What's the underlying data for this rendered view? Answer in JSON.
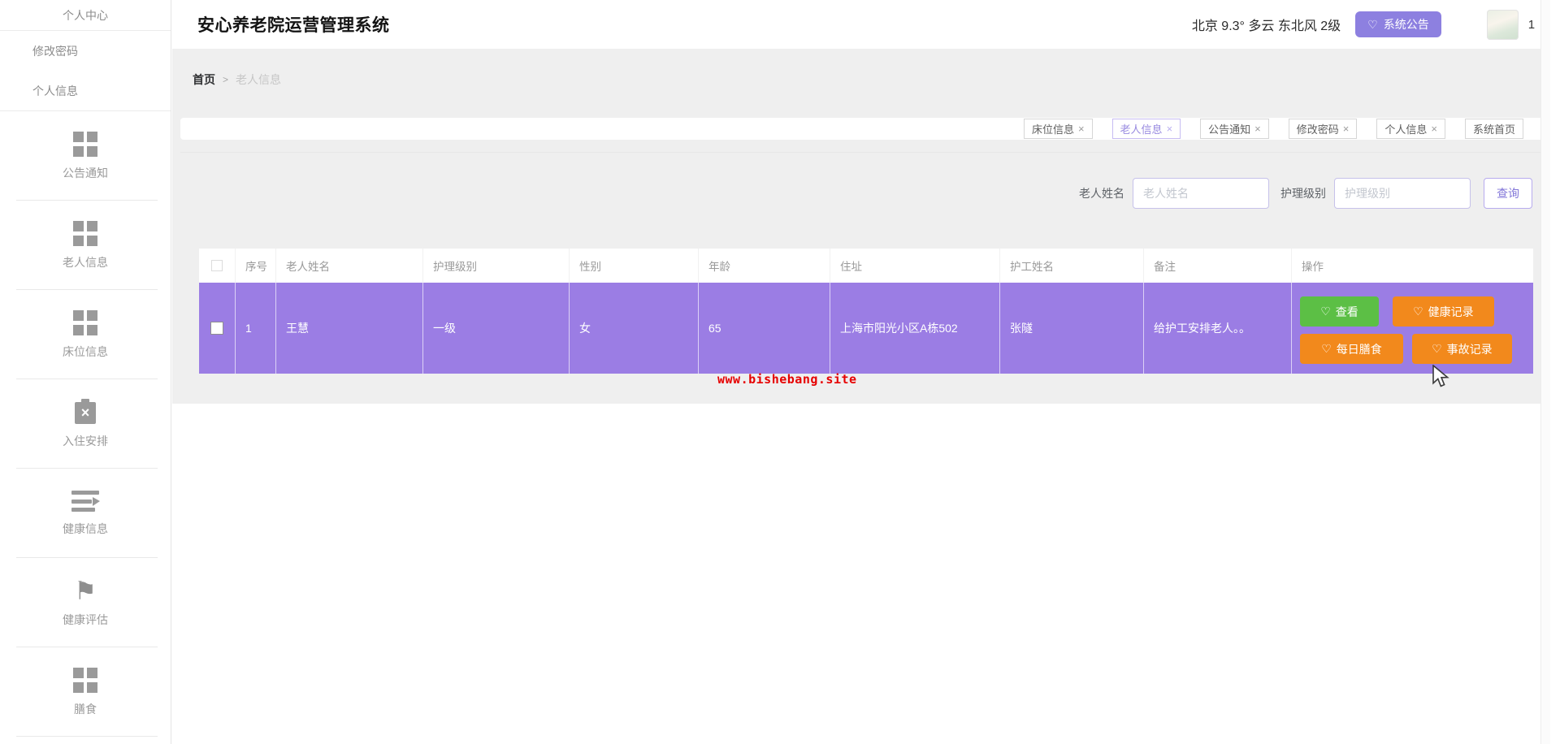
{
  "app": {
    "title": "安心养老院运营管理系统"
  },
  "header": {
    "weather": "北京  9.3°  多云  东北风  2级",
    "announcement_button": "系统公告",
    "user_badge": "1"
  },
  "sidebar": {
    "top_items": [
      {
        "label": "个人中心"
      },
      {
        "label": "修改密码"
      },
      {
        "label": "个人信息"
      }
    ],
    "menu_items": [
      {
        "label": "公告通知",
        "icon": "grid-icon"
      },
      {
        "label": "老人信息",
        "icon": "grid-icon"
      },
      {
        "label": "床位信息",
        "icon": "grid-icon"
      },
      {
        "label": "入住安排",
        "icon": "clipboard-x-icon"
      },
      {
        "label": "健康信息",
        "icon": "list-arrow-icon"
      },
      {
        "label": "健康评估",
        "icon": "flag-icon"
      },
      {
        "label": "膳食",
        "icon": "grid-icon"
      }
    ]
  },
  "breadcrumb": {
    "home": "首页",
    "separator": ">",
    "current": "老人信息"
  },
  "tabs": [
    {
      "label": "床位信息",
      "closable": true,
      "active": false
    },
    {
      "label": "老人信息",
      "closable": true,
      "active": true
    },
    {
      "label": "公告通知",
      "closable": true,
      "active": false
    },
    {
      "label": "修改密码",
      "closable": true,
      "active": false
    },
    {
      "label": "个人信息",
      "closable": true,
      "active": false
    },
    {
      "label": "系统首页",
      "closable": false,
      "active": false
    }
  ],
  "search": {
    "name_label": "老人姓名",
    "name_placeholder": "老人姓名",
    "level_label": "护理级别",
    "level_placeholder": "护理级别",
    "submit_label": "查询"
  },
  "table": {
    "columns": [
      "序号",
      "老人姓名",
      "护理级别",
      "性别",
      "年龄",
      "住址",
      "护工姓名",
      "备注",
      "操作"
    ],
    "rows": [
      {
        "index": "1",
        "name": "王慧",
        "care_level": "一级",
        "gender": "女",
        "age": "65",
        "address": "上海市阳光小区A栋502",
        "caregiver": "张隧",
        "remark": "给护工安排老人。。",
        "actions": [
          {
            "label": "查看",
            "color": "#5cbf45"
          },
          {
            "label": "健康记录",
            "color": "#f2891c"
          },
          {
            "label": "每日膳食",
            "color": "#f2891c"
          },
          {
            "label": "事故记录",
            "color": "#f2891c"
          }
        ]
      }
    ]
  },
  "watermark": "www.bishebang.site",
  "ui": {
    "heart": "♡",
    "close": "×",
    "caret": "▼",
    "flag": "⚑"
  },
  "colors": {
    "row_purple": "#9b7de4",
    "announce_purple": "#8d80e0",
    "action_green": "#5cbf45",
    "action_orange": "#f2891c",
    "watermark_red": "#e60000",
    "content_gray": "#efefef"
  }
}
